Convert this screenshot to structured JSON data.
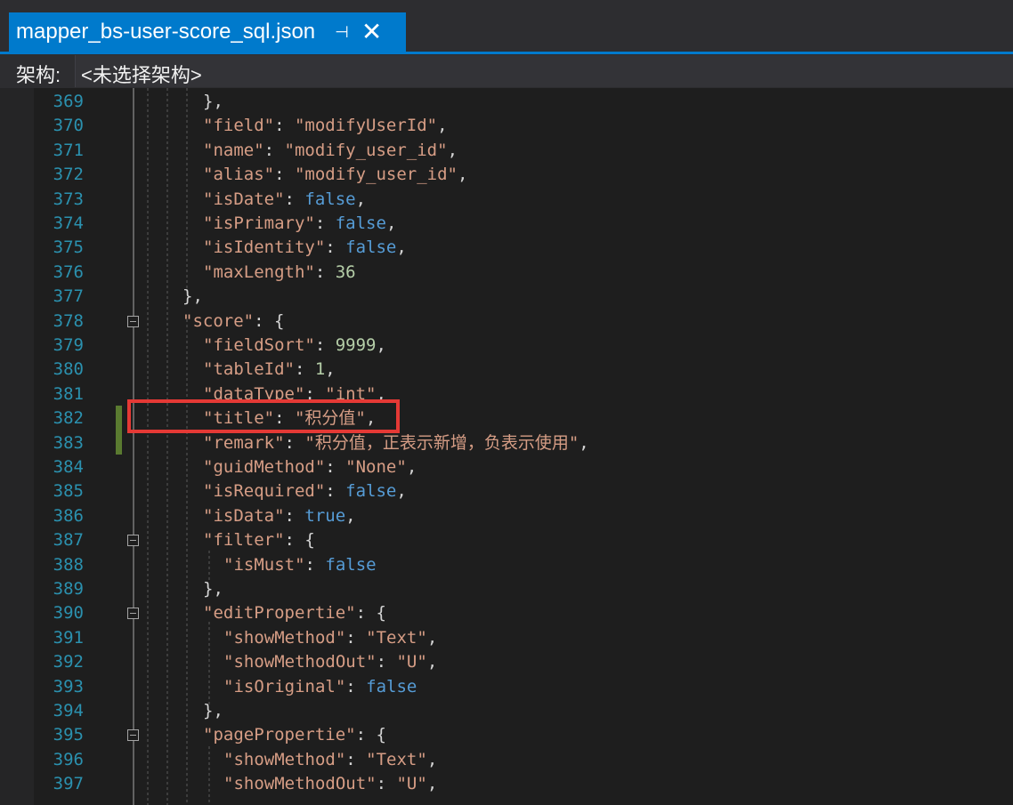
{
  "tab": {
    "title": "mapper_bs-user-score_sql.json",
    "pin_glyph": "⊣",
    "close_glyph": "✕"
  },
  "schema": {
    "label": "架构:",
    "value": "<未选择架构>"
  },
  "editor": {
    "lines": [
      {
        "num": "369",
        "indent": 0,
        "tokens": [
          [
            "p",
            "},"
          ]
        ]
      },
      {
        "num": "370",
        "indent": 0,
        "tokens": [
          [
            "k",
            "\"field\""
          ],
          [
            "p",
            ": "
          ],
          [
            "k",
            "\"modifyUserId\""
          ],
          [
            "p",
            ","
          ]
        ]
      },
      {
        "num": "371",
        "indent": 0,
        "tokens": [
          [
            "k",
            "\"name\""
          ],
          [
            "p",
            ": "
          ],
          [
            "k",
            "\"modify_user_id\""
          ],
          [
            "p",
            ","
          ]
        ]
      },
      {
        "num": "372",
        "indent": 0,
        "tokens": [
          [
            "k",
            "\"alias\""
          ],
          [
            "p",
            ": "
          ],
          [
            "k",
            "\"modify_user_id\""
          ],
          [
            "p",
            ","
          ]
        ]
      },
      {
        "num": "373",
        "indent": 0,
        "tokens": [
          [
            "k",
            "\"isDate\""
          ],
          [
            "p",
            ": "
          ],
          [
            "b",
            "false"
          ],
          [
            "p",
            ","
          ]
        ]
      },
      {
        "num": "374",
        "indent": 0,
        "tokens": [
          [
            "k",
            "\"isPrimary\""
          ],
          [
            "p",
            ": "
          ],
          [
            "b",
            "false"
          ],
          [
            "p",
            ","
          ]
        ]
      },
      {
        "num": "375",
        "indent": 0,
        "tokens": [
          [
            "k",
            "\"isIdentity\""
          ],
          [
            "p",
            ": "
          ],
          [
            "b",
            "false"
          ],
          [
            "p",
            ","
          ]
        ]
      },
      {
        "num": "376",
        "indent": 0,
        "tokens": [
          [
            "k",
            "\"maxLength\""
          ],
          [
            "p",
            ": "
          ],
          [
            "n",
            "36"
          ]
        ]
      },
      {
        "num": "377",
        "indent": -1,
        "tokens": [
          [
            "p",
            "},"
          ]
        ]
      },
      {
        "num": "378",
        "indent": -1,
        "fold": true,
        "tokens": [
          [
            "k",
            "\"score\""
          ],
          [
            "p",
            ": {"
          ]
        ]
      },
      {
        "num": "379",
        "indent": 0,
        "tokens": [
          [
            "k",
            "\"fieldSort\""
          ],
          [
            "p",
            ": "
          ],
          [
            "n",
            "9999"
          ],
          [
            "p",
            ","
          ]
        ]
      },
      {
        "num": "380",
        "indent": 0,
        "tokens": [
          [
            "k",
            "\"tableId\""
          ],
          [
            "p",
            ": "
          ],
          [
            "n",
            "1"
          ],
          [
            "p",
            ","
          ]
        ]
      },
      {
        "num": "381",
        "indent": 0,
        "tokens": [
          [
            "k",
            "\"dataType\""
          ],
          [
            "p",
            ": "
          ],
          [
            "k",
            "\"int\""
          ],
          [
            "p",
            ","
          ]
        ]
      },
      {
        "num": "382",
        "indent": 0,
        "tokens": [
          [
            "k",
            "\"title\""
          ],
          [
            "p",
            ": "
          ],
          [
            "k",
            "\"积分值\""
          ],
          [
            "p",
            ","
          ]
        ]
      },
      {
        "num": "383",
        "indent": 0,
        "tokens": [
          [
            "k",
            "\"remark\""
          ],
          [
            "p",
            ": "
          ],
          [
            "k",
            "\"积分值，正表示新增，负表示使用\""
          ],
          [
            "p",
            ","
          ]
        ]
      },
      {
        "num": "384",
        "indent": 0,
        "tokens": [
          [
            "k",
            "\"guidMethod\""
          ],
          [
            "p",
            ": "
          ],
          [
            "k",
            "\"None\""
          ],
          [
            "p",
            ","
          ]
        ]
      },
      {
        "num": "385",
        "indent": 0,
        "tokens": [
          [
            "k",
            "\"isRequired\""
          ],
          [
            "p",
            ": "
          ],
          [
            "b",
            "false"
          ],
          [
            "p",
            ","
          ]
        ]
      },
      {
        "num": "386",
        "indent": 0,
        "tokens": [
          [
            "k",
            "\"isData\""
          ],
          [
            "p",
            ": "
          ],
          [
            "b",
            "true"
          ],
          [
            "p",
            ","
          ]
        ]
      },
      {
        "num": "387",
        "indent": 0,
        "fold": true,
        "tokens": [
          [
            "k",
            "\"filter\""
          ],
          [
            "p",
            ": {"
          ]
        ]
      },
      {
        "num": "388",
        "indent": 1,
        "tokens": [
          [
            "k",
            "\"isMust\""
          ],
          [
            "p",
            ": "
          ],
          [
            "b",
            "false"
          ]
        ]
      },
      {
        "num": "389",
        "indent": 0,
        "tokens": [
          [
            "p",
            "},"
          ]
        ]
      },
      {
        "num": "390",
        "indent": 0,
        "fold": true,
        "tokens": [
          [
            "k",
            "\"editPropertie\""
          ],
          [
            "p",
            ": {"
          ]
        ]
      },
      {
        "num": "391",
        "indent": 1,
        "tokens": [
          [
            "k",
            "\"showMethod\""
          ],
          [
            "p",
            ": "
          ],
          [
            "k",
            "\"Text\""
          ],
          [
            "p",
            ","
          ]
        ]
      },
      {
        "num": "392",
        "indent": 1,
        "tokens": [
          [
            "k",
            "\"showMethodOut\""
          ],
          [
            "p",
            ": "
          ],
          [
            "k",
            "\"U\""
          ],
          [
            "p",
            ","
          ]
        ]
      },
      {
        "num": "393",
        "indent": 1,
        "tokens": [
          [
            "k",
            "\"isOriginal\""
          ],
          [
            "p",
            ": "
          ],
          [
            "b",
            "false"
          ]
        ]
      },
      {
        "num": "394",
        "indent": 0,
        "tokens": [
          [
            "p",
            "},"
          ]
        ]
      },
      {
        "num": "395",
        "indent": 0,
        "fold": true,
        "tokens": [
          [
            "k",
            "\"pagePropertie\""
          ],
          [
            "p",
            ": {"
          ]
        ]
      },
      {
        "num": "396",
        "indent": 1,
        "tokens": [
          [
            "k",
            "\"showMethod\""
          ],
          [
            "p",
            ": "
          ],
          [
            "k",
            "\"Text\""
          ],
          [
            "p",
            ","
          ]
        ]
      },
      {
        "num": "397",
        "indent": 1,
        "tokens": [
          [
            "k",
            "\"showMethodOut\""
          ],
          [
            "p",
            ": "
          ],
          [
            "k",
            "\"U\""
          ],
          [
            "p",
            ","
          ]
        ]
      }
    ]
  }
}
